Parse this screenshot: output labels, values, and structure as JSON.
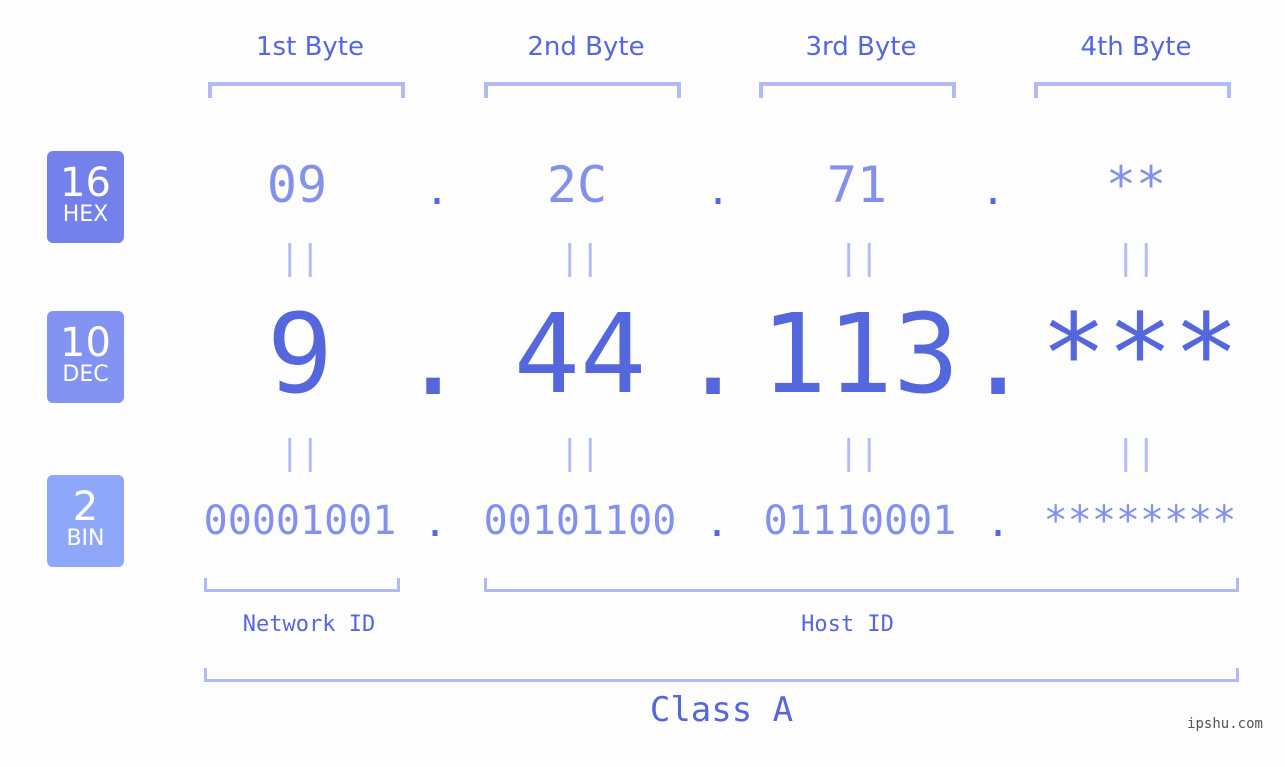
{
  "byte_headers": [
    "1st Byte",
    "2nd Byte",
    "3rd Byte",
    "4th Byte"
  ],
  "badges": [
    {
      "num": "16",
      "label": "HEX",
      "color": "#7481eb"
    },
    {
      "num": "10",
      "label": "DEC",
      "color": "#8393f2"
    },
    {
      "num": "2",
      "label": "BIN",
      "color": "#8fa7f8"
    }
  ],
  "hex": [
    "09",
    "2C",
    "71",
    "**"
  ],
  "dec": [
    "9",
    "44",
    "113",
    "***"
  ],
  "bin": [
    "00001001",
    "00101100",
    "01110001",
    "********"
  ],
  "separator": ".",
  "equals": "||",
  "network_label": "Network ID",
  "host_label": "Host ID",
  "class_label": "Class A",
  "watermark": "ipshu.com"
}
